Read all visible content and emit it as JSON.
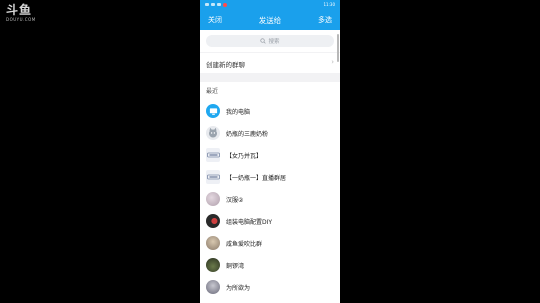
{
  "watermark": {
    "main": "斗鱼",
    "sub": "DOUYU.COM"
  },
  "status_bar": {
    "time": "11:30"
  },
  "nav": {
    "close": "关闭",
    "title": "发送给",
    "multi_select": "多选"
  },
  "search": {
    "placeholder": "搜索"
  },
  "create_group": {
    "label": "创建新的群聊"
  },
  "recent": {
    "header": "最近",
    "items": [
      {
        "name": "我的电脑",
        "avatar_color": "#1fa8f0"
      },
      {
        "name": "奶瓶的三鹿奶粉",
        "avatar_color": "#9aa3ad"
      },
      {
        "name": "【女乃并瓦】",
        "avatar_color": "#7c8aa6"
      },
      {
        "name": "【一奶瓶一】直播群居",
        "avatar_color": "#7c8aa6"
      },
      {
        "name": "汉服②",
        "avatar_color": "#c8b8c4"
      },
      {
        "name": "组装电脑配置DIY",
        "avatar_color": "#2a2a2a"
      },
      {
        "name": "咸鱼爱吹比群",
        "avatar_color": "#8a7a6a"
      },
      {
        "name": "銅锣湾",
        "avatar_color": "#4a5a3a"
      },
      {
        "name": "为所欲为",
        "avatar_color": "#6a6a7a"
      }
    ]
  }
}
